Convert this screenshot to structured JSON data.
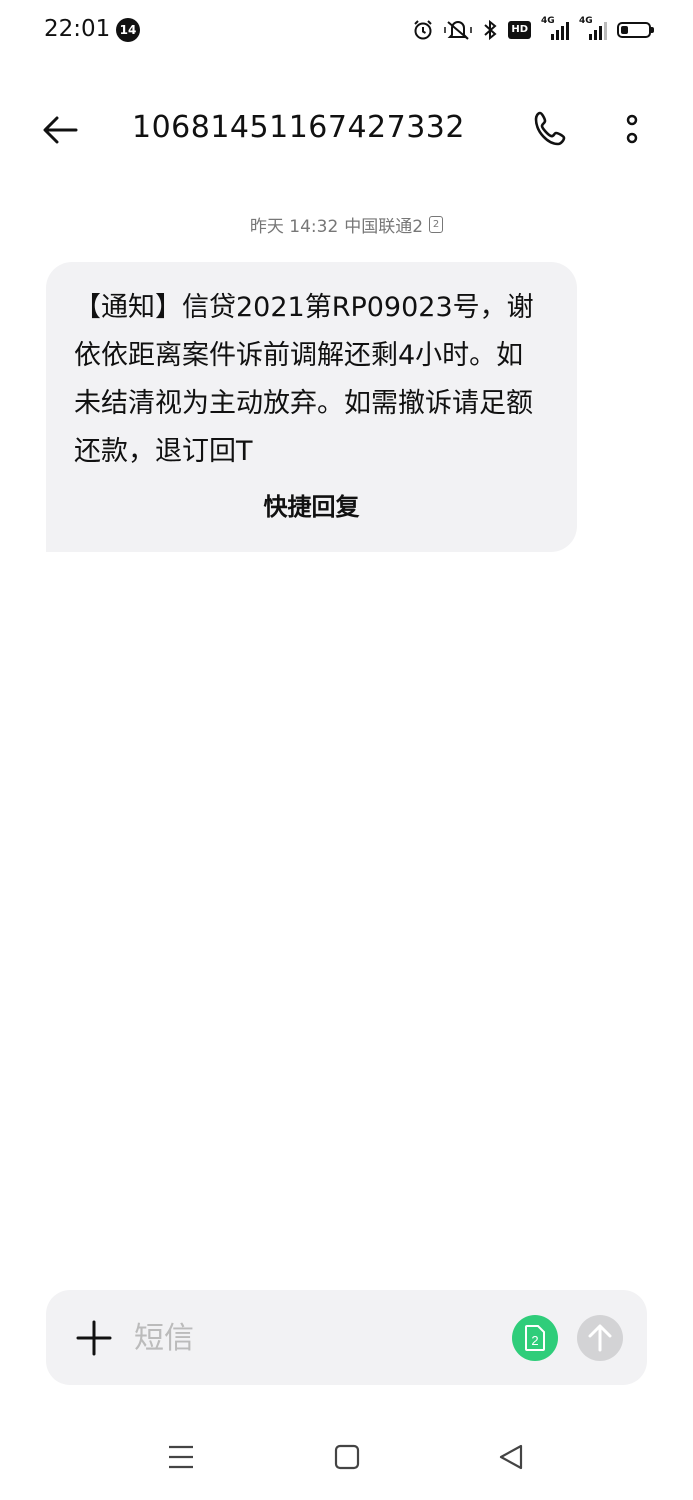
{
  "status_bar": {
    "time": "22:01",
    "notification_count": "14",
    "hd_label": "HD",
    "sim1_network": "4G",
    "sim2_network": "4G",
    "battery_level": 0.25
  },
  "header": {
    "title": "10681451167427332"
  },
  "conversation": {
    "date_time": "昨天 14:32",
    "carrier": "中国联通2",
    "sim_number": "2",
    "messages": [
      {
        "text": "【通知】信贷2021第RP09023号，谢依依距离案件诉前调解还剩4小时。如未结清视为主动放弃。如需撤诉请足额还款，退订回T",
        "quick_reply_label": "快捷回复"
      }
    ]
  },
  "composer": {
    "placeholder": "短信",
    "sim_number": "2"
  },
  "colors": {
    "accent_green": "#2fcd7a",
    "bubble_bg": "#f2f2f4",
    "send_disabled": "#d3d3d5"
  }
}
